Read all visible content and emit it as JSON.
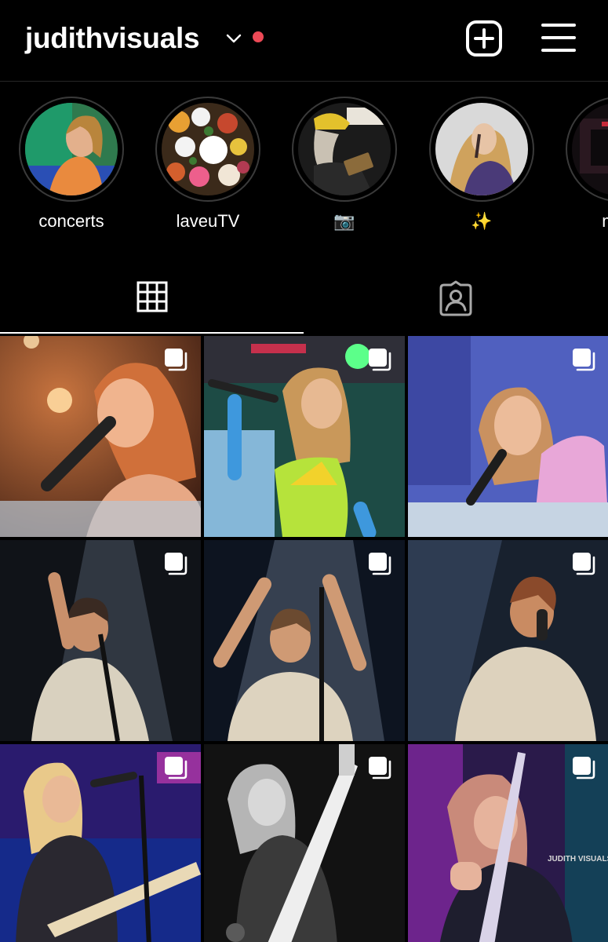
{
  "header": {
    "username": "judithvisuals",
    "notification_dot_color": "#ed4956",
    "icons": {
      "switch_account": "chevron-down-icon",
      "new_post": "plus-square-icon",
      "menu": "hamburger-menu-icon"
    }
  },
  "highlights": [
    {
      "label": "concerts"
    },
    {
      "label": "laveuTV"
    },
    {
      "label": "📷"
    },
    {
      "label": "✨"
    },
    {
      "label": "mak"
    }
  ],
  "tabs": [
    {
      "name": "posts-grid",
      "icon": "grid-icon",
      "active": true
    },
    {
      "name": "tagged",
      "icon": "tagged-person-icon",
      "active": false
    }
  ],
  "posts": [
    {
      "multiple": true,
      "watermark": ""
    },
    {
      "multiple": true,
      "watermark": ""
    },
    {
      "multiple": true,
      "watermark": ""
    },
    {
      "multiple": true,
      "watermark": ""
    },
    {
      "multiple": true,
      "watermark": ""
    },
    {
      "multiple": true,
      "watermark": ""
    },
    {
      "multiple": true,
      "watermark": ""
    },
    {
      "multiple": true,
      "watermark": ""
    },
    {
      "multiple": true,
      "watermark": "JUDITH VISUALS"
    }
  ],
  "colors": {
    "background": "#000000",
    "divider": "#262626",
    "accent_dot": "#ed4956"
  }
}
